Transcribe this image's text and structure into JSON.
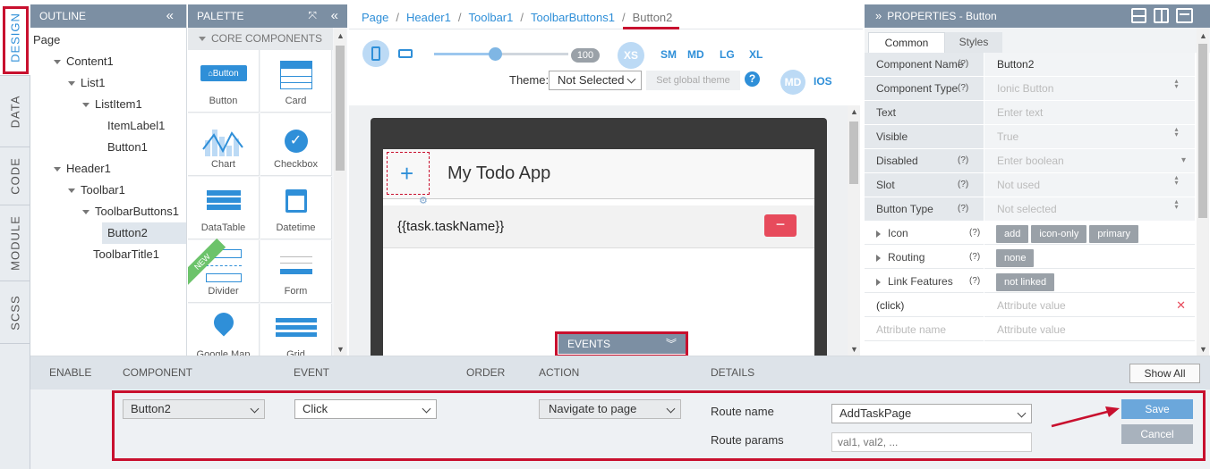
{
  "sidebar_tabs": [
    "DESIGN",
    "DATA",
    "CODE",
    "MODULE",
    "SCSS"
  ],
  "outline": {
    "title": "OUTLINE",
    "collapse_icon": "double-chevron-left",
    "items": [
      {
        "label": "Page",
        "level": 0,
        "expander": false
      },
      {
        "label": "Content1",
        "level": 1,
        "expander": true
      },
      {
        "label": "List1",
        "level": 2,
        "expander": true
      },
      {
        "label": "ListItem1",
        "level": 3,
        "expander": true
      },
      {
        "label": "ItemLabel1",
        "level": 4,
        "expander": false
      },
      {
        "label": "Button1",
        "level": 4,
        "expander": false
      },
      {
        "label": "Header1",
        "level": 1,
        "expander": true
      },
      {
        "label": "Toolbar1",
        "level": 2,
        "expander": true
      },
      {
        "label": "ToolbarButtons1",
        "level": 3,
        "expander": true
      },
      {
        "label": "Button2",
        "level": 4,
        "expander": false,
        "selected": true
      },
      {
        "label": "ToolbarTitle1",
        "level": 3,
        "expander": false
      }
    ]
  },
  "palette": {
    "title": "PALETTE",
    "section": "CORE COMPONENTS",
    "items": [
      "Button",
      "Card",
      "Chart",
      "Checkbox",
      "DataTable",
      "Datetime",
      "Divider",
      "Form",
      "Google Map",
      "Grid"
    ],
    "new_badge": "NEW",
    "button_preview": "Button"
  },
  "breadcrumb": [
    "Page",
    "Header1",
    "Toolbar1",
    "ToolbarButtons1",
    "Button2"
  ],
  "toolbar": {
    "zoom_value": "100",
    "zoom_fraction": 0.45,
    "sizes": [
      "XS",
      "SM",
      "MD",
      "LG",
      "XL"
    ],
    "active_size": "XS",
    "theme_label": "Theme:",
    "theme_value": "Not Selected",
    "set_theme_button": "Set global theme",
    "help_icon": "?",
    "platforms": [
      "MD",
      "IOS"
    ],
    "active_platform": "MD"
  },
  "device": {
    "app_title": "My Todo App",
    "add_icon": "+",
    "list_item_text": "{{task.taskName}}",
    "remove_icon": "−",
    "events_label": "EVENTS"
  },
  "properties": {
    "title": "PROPERTIES - Button",
    "tabs": [
      "Common",
      "Styles"
    ],
    "active_tab": "Common",
    "rows": [
      {
        "key": "Component Name",
        "help": "(?)",
        "value": "Button2",
        "filled": true,
        "control": "none"
      },
      {
        "key": "Component Type",
        "help": "(?)",
        "value": "Ionic Button",
        "filled": false,
        "control": "spinner"
      },
      {
        "key": "Text",
        "help": "",
        "value": "Enter text",
        "filled": false,
        "control": "none"
      },
      {
        "key": "Visible",
        "help": "",
        "value": "True",
        "filled": false,
        "control": "spinner"
      },
      {
        "key": "Disabled",
        "help": "(?)",
        "value": "Enter boolean",
        "filled": false,
        "control": "dropdown"
      },
      {
        "key": "Slot",
        "help": "(?)",
        "value": "Not used",
        "filled": false,
        "control": "spinner"
      },
      {
        "key": "Button Type",
        "help": "(?)",
        "value": "Not selected",
        "filled": false,
        "control": "spinner"
      }
    ],
    "groups": [
      {
        "key": "Icon",
        "help": "(?)",
        "chips": [
          "add",
          "icon-only",
          "primary"
        ]
      },
      {
        "key": "Routing",
        "help": "(?)",
        "chips": [
          "none"
        ]
      },
      {
        "key": "Link Features",
        "help": "(?)",
        "chips": [
          "not linked"
        ]
      }
    ],
    "click_row": {
      "key": "(click)",
      "value": "Attribute value",
      "remove_icon": "✕"
    },
    "new_attr": {
      "name": "Attribute name",
      "value": "Attribute value"
    }
  },
  "events_panel": {
    "headers": [
      "ENABLE",
      "COMPONENT",
      "EVENT",
      "ORDER",
      "ACTION",
      "DETAILS"
    ],
    "show_all": "Show All",
    "component": "Button2",
    "event": "Click",
    "action": "Navigate to page",
    "route_name_label": "Route name",
    "route_name_value": "AddTaskPage",
    "route_params_label": "Route params",
    "route_params_placeholder": "val1, val2, ...",
    "save": "Save",
    "cancel": "Cancel"
  },
  "colors": {
    "header_bg": "#7c8fa3",
    "accent": "#2f8fd8",
    "highlight": "#c8102e",
    "danger": "#e74b5c"
  }
}
